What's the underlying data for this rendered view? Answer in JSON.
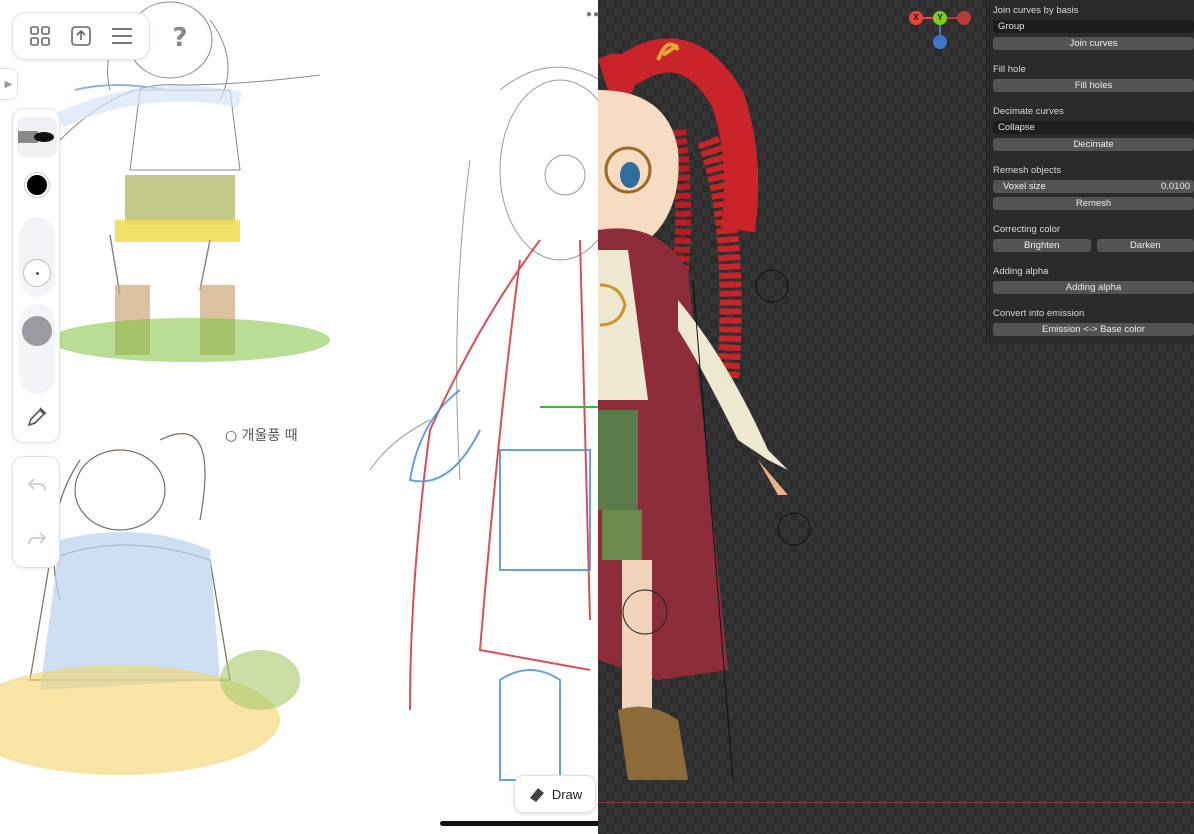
{
  "left": {
    "toolbar": {
      "gallery_icon": "grid-icon",
      "export_icon": "share-upload-icon",
      "menu_icon": "hamburger-icon"
    },
    "help_glyph": "?",
    "draw_mode_label": "Draw",
    "sketch_annotation": "○ 개울풍 때"
  },
  "right": {
    "gizmo": {
      "x": "X",
      "y": "Y",
      "z": "Z"
    },
    "panel": {
      "join_title": "Join curves by basis",
      "join_select": "Group",
      "join_button": "Join curves",
      "fill_title": "Fill hole",
      "fill_button": "Fill holes",
      "decimate_title": "Decimate curves",
      "decimate_select": "Collapse",
      "decimate_button": "Decimate",
      "remesh_title": "Remesh objects",
      "voxel_label": "Voxel size",
      "voxel_value": "0.0100",
      "remesh_button": "Remesh",
      "color_title": "Correcting color",
      "brighten_button": "Brighten",
      "darken_button": "Darken",
      "alpha_title": "Adding alpha",
      "alpha_button": "Adding alpha",
      "emission_title": "Convert into emission",
      "emission_button": "Emission <-> Base color"
    }
  },
  "colors": {
    "panel_bg": "#2b2b2b",
    "button_bg": "#545454",
    "gizmo_x": "#e8413e",
    "gizmo_y": "#7dcc1f",
    "gizmo_z": "#3f74c8",
    "hair_red": "#c8242a",
    "cape_maroon": "#8e2d3a"
  }
}
